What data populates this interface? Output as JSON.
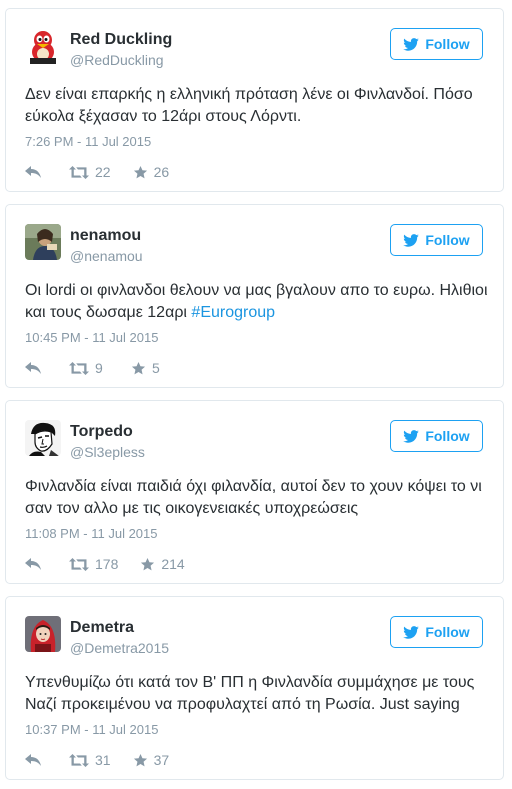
{
  "colors": {
    "accent": "#1da1f2",
    "text": "#292f33",
    "muted": "#8899a6",
    "border": "#e1e8ed",
    "hashtag": "#1b95e0"
  },
  "tweets": [
    {
      "name": "Red Duckling",
      "handle": "@RedDuckling",
      "follow_label": "Follow",
      "text_before": "Δεν είναι επαρκής η ελληνική πρόταση λένε οι Φινλανδοί. Πόσο εύκολα ξέχασαν το 12άρι στους Λόρντι.",
      "hashtag": "",
      "time": "7:26 PM - 11 Jul 2015",
      "retweets": "22",
      "likes": "26",
      "avatar_icon": "red-penguin-icon"
    },
    {
      "name": "nenamou",
      "handle": "@nenamou",
      "follow_label": "Follow",
      "text_before": "Οι lordi οι φινλανδοι θελουν να μας βγαλουν απο το ευρω. Ηλιθιοι και τους δωσαμε 12αρι ",
      "hashtag": "#Eurogroup",
      "time": "10:45 PM - 11 Jul 2015",
      "retweets": "9",
      "likes": "5",
      "avatar_icon": "photo-avatar-icon"
    },
    {
      "name": "Torpedo",
      "handle": "@Sl3epless",
      "follow_label": "Follow",
      "text_before": "Φινλανδία είναι παιδιά όχι φιλανδία, αυτοί δεν το χουν κόψει το νι σαν τον αλλο με τις οικογενειακές υποχρεώσεις",
      "hashtag": "",
      "time": "11:08 PM - 11 Jul 2015",
      "retweets": "178",
      "likes": "214",
      "avatar_icon": "comic-face-icon"
    },
    {
      "name": "Demetra",
      "handle": "@Demetra2015",
      "follow_label": "Follow",
      "text_before": "Υπενθυμίζω ότι κατά τον Β' ΠΠ η Φινλανδία συμμάχησε με τους Ναζί προκειμένου να προφυλαχτεί από τη Ρωσία. Just saying",
      "hashtag": "",
      "time": "10:37 PM - 11 Jul 2015",
      "retweets": "31",
      "likes": "37",
      "avatar_icon": "red-hood-icon"
    }
  ]
}
